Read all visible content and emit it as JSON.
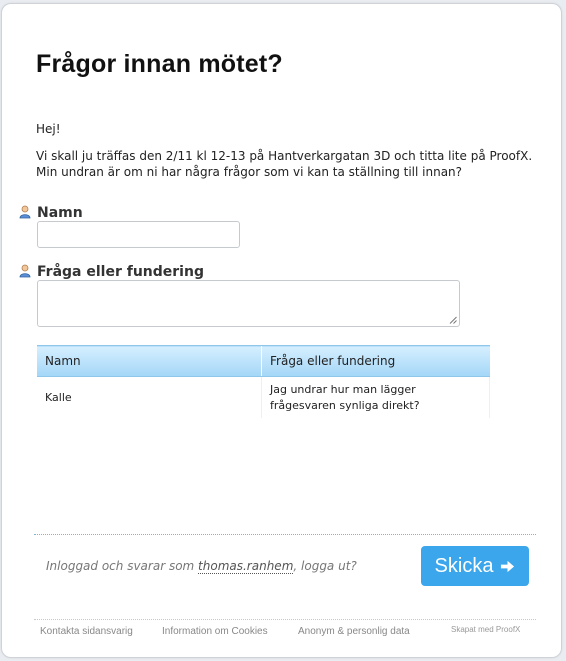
{
  "form": {
    "title": "Frågor innan mötet?",
    "greeting": "Hej!",
    "intro_line1": "Vi skall ju träffas den 2/11 kl 12-13 på Hantverkargatan 3D och titta lite på ProofX.",
    "intro_line2": "Min undran är om ni har några frågor som vi kan ta ställning till innan?",
    "fields": [
      {
        "label": "Namn",
        "value": "",
        "icon": "user-icon"
      },
      {
        "label": "Fråga eller fundering",
        "value": "",
        "icon": "user-icon"
      }
    ]
  },
  "answers_table": {
    "headers": [
      "Namn",
      "Fråga eller fundering"
    ],
    "rows": [
      [
        "Kalle",
        "Jag undrar hur man lägger frågesvaren synliga direkt?"
      ]
    ]
  },
  "session": {
    "prefix": "Inloggad och svarar som ",
    "username": "thomas.ranhem",
    "logout": ", logga ut?"
  },
  "submit": {
    "label": "Skicka",
    "icon": "arrow-right-icon",
    "color": "#3ba6ec"
  },
  "footer": {
    "links": [
      "Kontakta sidansvarig",
      "Information om Cookies",
      "Anonym & personlig data"
    ],
    "credit": "Skapat med ProofX"
  }
}
